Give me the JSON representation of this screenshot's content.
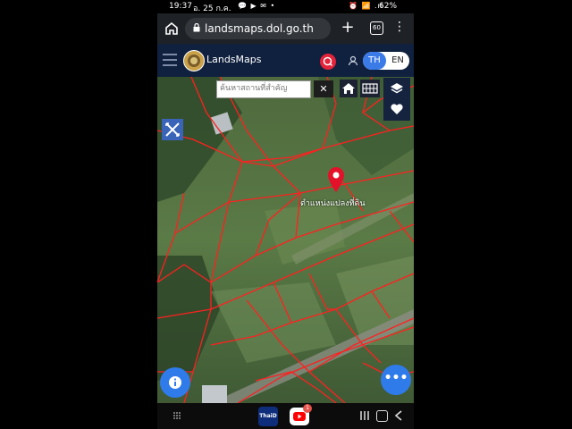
{
  "status_bar": {
    "time": "19:37",
    "date": "อ. 25 ก.ค.",
    "notifications": "💬 ▶ ✉ •",
    "system": "⏰ 📶 .ıl",
    "battery": "62%"
  },
  "browser": {
    "url": "landsmaps.dol.go.th",
    "tab_count": "60",
    "icons": [
      "home-icon",
      "lock-icon",
      "plus-icon",
      "tabs-icon",
      "more-vert-icon"
    ]
  },
  "app_header": {
    "brand": "LandsMaps",
    "lang_th": "TH",
    "lang_en": "EN",
    "colors": {
      "header_bg": "#10213f",
      "search_red": "#e3233a",
      "lang_active": "#3b7be8"
    }
  },
  "map": {
    "search_placeholder": "ค้นหาสถานที่สำคัญ",
    "clear_label": "✕",
    "pin_label": "ตำแหน่งแปลงที่ดิน",
    "more_label": "•••",
    "colors": {
      "parcel_lines": "#ff2020",
      "fab": "#2f7bea"
    },
    "icons": [
      "home-icon",
      "grid-icon",
      "layers-icon",
      "heart-icon",
      "measure-icon",
      "location-pin-icon",
      "info-icon",
      "more-horiz-icon"
    ]
  },
  "nav_bar": {
    "thaiid_label": "ThaiD",
    "youtube_badge": "1",
    "icons": [
      "app-drawer-icon",
      "thaid-app-icon",
      "youtube-app-icon",
      "recents-icon",
      "home-icon",
      "back-icon"
    ]
  }
}
